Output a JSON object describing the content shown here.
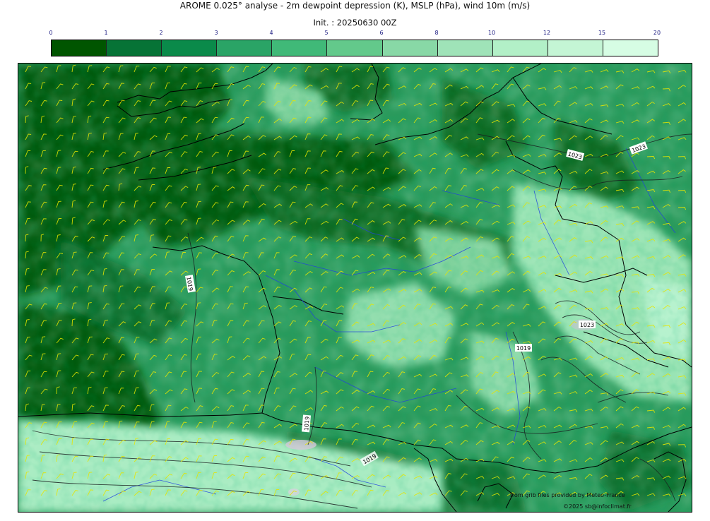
{
  "header": {
    "title": "AROME 0.025° analyse - 2m dewpoint depression (K), MSLP (hPa), wind 10m (m/s)",
    "init": "Init. : 20250630 00Z"
  },
  "colorbar": {
    "ticks": [
      "0",
      "1",
      "2",
      "3",
      "4",
      "5",
      "6",
      "8",
      "10",
      "12",
      "15",
      "20"
    ],
    "colors": [
      "#005500",
      "#067336",
      "#0a8a4a",
      "#2aa466",
      "#40b978",
      "#63c98b",
      "#88d8a6",
      "#9fe3b8",
      "#b2f0c7",
      "#c4f5d5",
      "#d6fde4"
    ]
  },
  "map": {
    "isobar_labels": [
      "1023",
      "1023",
      "1019",
      "1023",
      "1019",
      "1019",
      "1019"
    ]
  },
  "footer": {
    "source": "from grib files provided by Meteo-France",
    "copyright": "©2025 sb@infoclimat.fr"
  }
}
